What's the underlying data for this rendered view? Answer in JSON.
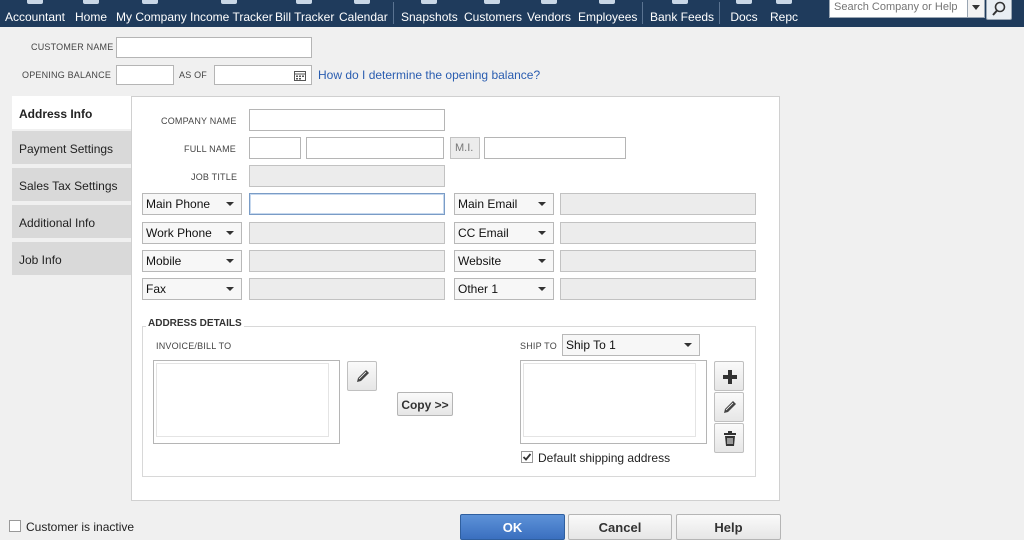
{
  "toolbar": {
    "items": [
      "Accountant",
      "Home",
      "My Company",
      "Income Tracker",
      "Bill Tracker",
      "Calendar",
      "Snapshots",
      "Customers",
      "Vendors",
      "Employees",
      "Bank Feeds",
      "Docs",
      "Repc"
    ],
    "search_placeholder": "Search Company or Help"
  },
  "header": {
    "customer_name_label": "CUSTOMER NAME",
    "customer_name_value": "",
    "opening_balance_label": "OPENING BALANCE",
    "opening_balance_value": "",
    "as_of_label": "AS OF",
    "as_of_value": "",
    "help_link": "How do I determine the opening balance?"
  },
  "tabs": [
    "Address Info",
    "Payment Settings",
    "Sales Tax Settings",
    "Additional Info",
    "Job Info"
  ],
  "address_info": {
    "company_name_label": "COMPANY NAME",
    "full_name_label": "FULL NAME",
    "mi_label": "M.I.",
    "job_title_label": "JOB TITLE",
    "phone_selects": [
      "Main Phone",
      "Work Phone",
      "Mobile",
      "Fax"
    ],
    "email_selects": [
      "Main Email",
      "CC Email",
      "Website",
      "Other 1"
    ]
  },
  "address_details": {
    "section_label": "ADDRESS DETAILS",
    "bill_to_label": "INVOICE/BILL TO",
    "ship_to_label": "SHIP TO",
    "ship_to_selected": "Ship To 1",
    "copy_button": "Copy >>",
    "default_shipping_label": "Default shipping address",
    "default_shipping_checked": true
  },
  "footer": {
    "inactive_label": "Customer is inactive",
    "ok": "OK",
    "cancel": "Cancel",
    "help": "Help"
  }
}
